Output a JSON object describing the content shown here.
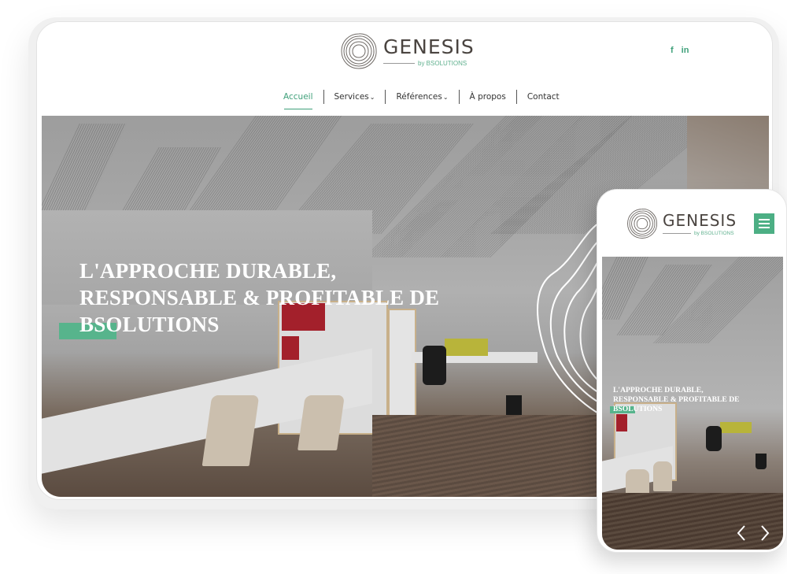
{
  "brand": {
    "name": "GENESIS",
    "tagline": "by BSOLUTIONS"
  },
  "colors": {
    "accent": "#57b48c",
    "accent_text": "#3fa07a",
    "brand_text": "#4a4440"
  },
  "social": [
    {
      "icon": "facebook-icon",
      "label": "f"
    },
    {
      "icon": "linkedin-icon",
      "label": "in"
    }
  ],
  "nav": {
    "items": [
      {
        "label": "Accueil",
        "active": true,
        "dropdown": false
      },
      {
        "label": "Services",
        "active": false,
        "dropdown": true
      },
      {
        "label": "Références",
        "active": false,
        "dropdown": true
      },
      {
        "label": "À propos",
        "active": false,
        "dropdown": false
      },
      {
        "label": "Contact",
        "active": false,
        "dropdown": false
      }
    ],
    "dropdown_caret": "⌄"
  },
  "hero": {
    "line1": "L'APPROCHE DURABLE,",
    "line2": "RESPONSABLE & PROFITABLE DE",
    "line3": "BSOLUTIONS"
  },
  "mobile": {
    "menu_icon": "hamburger-menu-icon",
    "hero": {
      "line1": "L'APPROCHE DURABLE,",
      "line2": "RESPONSABLE & PROFITABLE DE",
      "line3": "BSOLUTIONS"
    },
    "prev_icon": "chevron-left-icon",
    "next_icon": "chevron-right-icon"
  }
}
